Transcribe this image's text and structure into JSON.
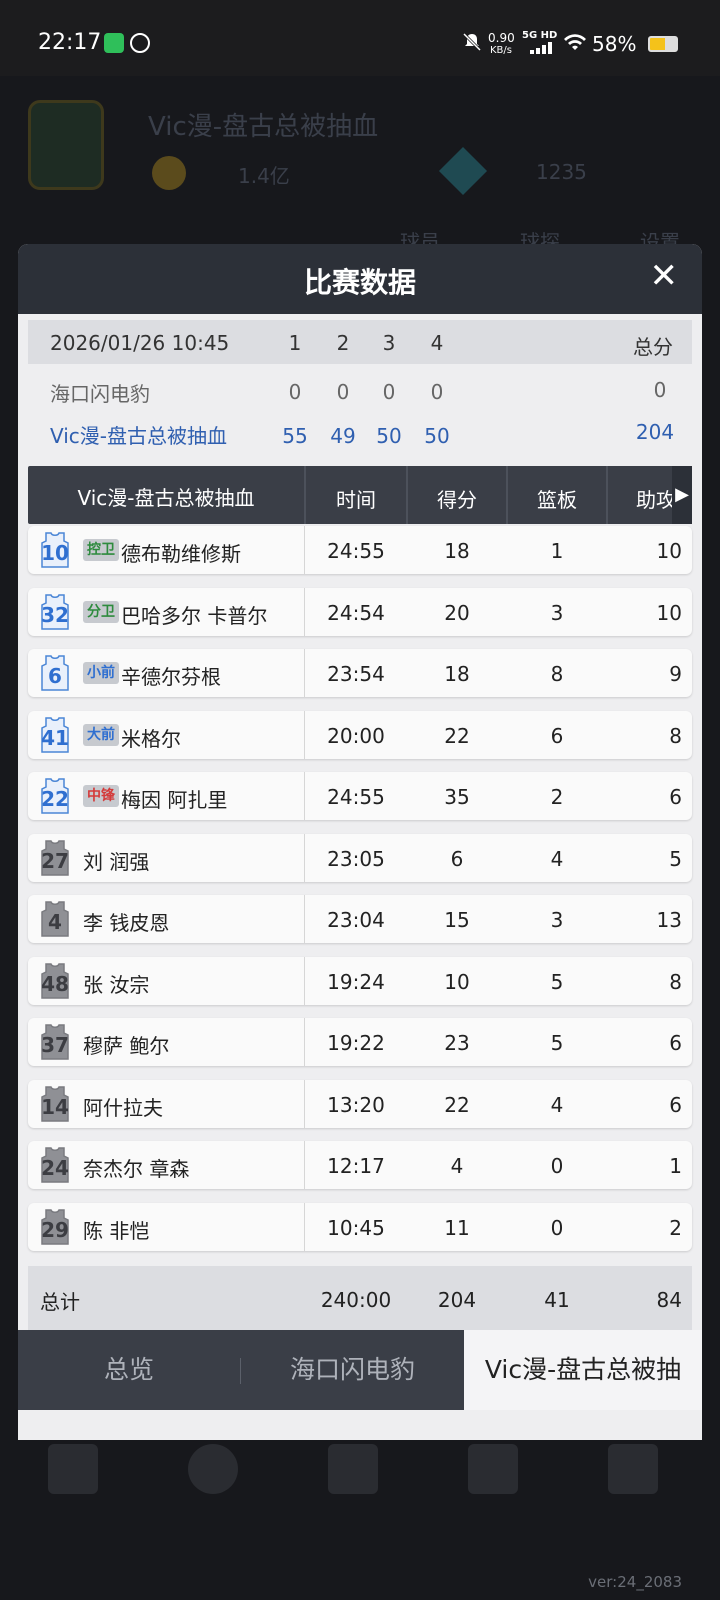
{
  "status_bar": {
    "time": "22:17",
    "net_speed_value": "0.90",
    "net_speed_unit": "KB/s",
    "network": "5G HD",
    "battery": "58%"
  },
  "background": {
    "team_name": "Vic漫-盘古总被抽血",
    "coins": "1.4亿",
    "gems": "1235",
    "nav1": "球员",
    "nav2": "球探",
    "nav3": "设置"
  },
  "modal": {
    "title": "比赛数据",
    "close": "✕",
    "quarter_header": {
      "date": "2026/01/26 10:45",
      "q": [
        "1",
        "2",
        "3",
        "4"
      ],
      "total_label": "总分"
    },
    "teams": [
      {
        "name": "海口闪电豹",
        "q": [
          "0",
          "0",
          "0",
          "0"
        ],
        "total": "0",
        "color": "#666666"
      },
      {
        "name": "Vic漫-盘古总被抽血",
        "q": [
          "55",
          "49",
          "50",
          "50"
        ],
        "total": "204",
        "color": "#2f5fb0"
      }
    ],
    "table": {
      "team": "Vic漫-盘古总被抽血",
      "columns": [
        "时间",
        "得分",
        "篮板",
        "助攻"
      ],
      "players": [
        {
          "num": "10",
          "pos": "控卫",
          "name": "德布勒维修斯",
          "time": "24:55",
          "pts": "18",
          "reb": "1",
          "ast": "10",
          "starter": true
        },
        {
          "num": "32",
          "pos": "分卫",
          "name": "巴哈多尔 卡普尔",
          "time": "24:54",
          "pts": "20",
          "reb": "3",
          "ast": "10",
          "starter": true
        },
        {
          "num": "6",
          "pos": "小前",
          "name": "辛德尔芬根",
          "time": "23:54",
          "pts": "18",
          "reb": "8",
          "ast": "9",
          "starter": true
        },
        {
          "num": "41",
          "pos": "大前",
          "name": "米格尔",
          "time": "20:00",
          "pts": "22",
          "reb": "6",
          "ast": "8",
          "starter": true
        },
        {
          "num": "22",
          "pos": "中锋",
          "name": "梅因 阿扎里",
          "time": "24:55",
          "pts": "35",
          "reb": "2",
          "ast": "6",
          "starter": true
        },
        {
          "num": "27",
          "pos": "",
          "name": "刘 润强",
          "time": "23:05",
          "pts": "6",
          "reb": "4",
          "ast": "5",
          "starter": false
        },
        {
          "num": "4",
          "pos": "",
          "name": "李 钱皮恩",
          "time": "23:04",
          "pts": "15",
          "reb": "3",
          "ast": "13",
          "starter": false
        },
        {
          "num": "48",
          "pos": "",
          "name": "张 汝宗",
          "time": "19:24",
          "pts": "10",
          "reb": "5",
          "ast": "8",
          "starter": false
        },
        {
          "num": "37",
          "pos": "",
          "name": "穆萨 鲍尔",
          "time": "19:22",
          "pts": "23",
          "reb": "5",
          "ast": "6",
          "starter": false
        },
        {
          "num": "14",
          "pos": "",
          "name": "阿什拉夫",
          "time": "13:20",
          "pts": "22",
          "reb": "4",
          "ast": "6",
          "starter": false
        },
        {
          "num": "24",
          "pos": "",
          "name": "奈杰尔 章森",
          "time": "12:17",
          "pts": "4",
          "reb": "0",
          "ast": "1",
          "starter": false
        },
        {
          "num": "29",
          "pos": "",
          "name": "陈 非恺",
          "time": "10:45",
          "pts": "11",
          "reb": "0",
          "ast": "2",
          "starter": false
        }
      ],
      "totals": {
        "label": "总计",
        "time": "240:00",
        "pts": "204",
        "reb": "41",
        "ast": "84"
      }
    },
    "tabs": [
      {
        "label": "总览",
        "active": false
      },
      {
        "label": "海口闪电豹",
        "active": false
      },
      {
        "label": "Vic漫-盘古总被抽",
        "active": true
      }
    ]
  },
  "version": "ver:24_2083",
  "colors": {
    "header_dark": "#2c3038",
    "team_blue": "#2f5fb0",
    "pos_guard_green": "#2e8b3e",
    "pos_forward_blue": "#2f6fd0",
    "pos_center_red": "#d43b3b"
  }
}
